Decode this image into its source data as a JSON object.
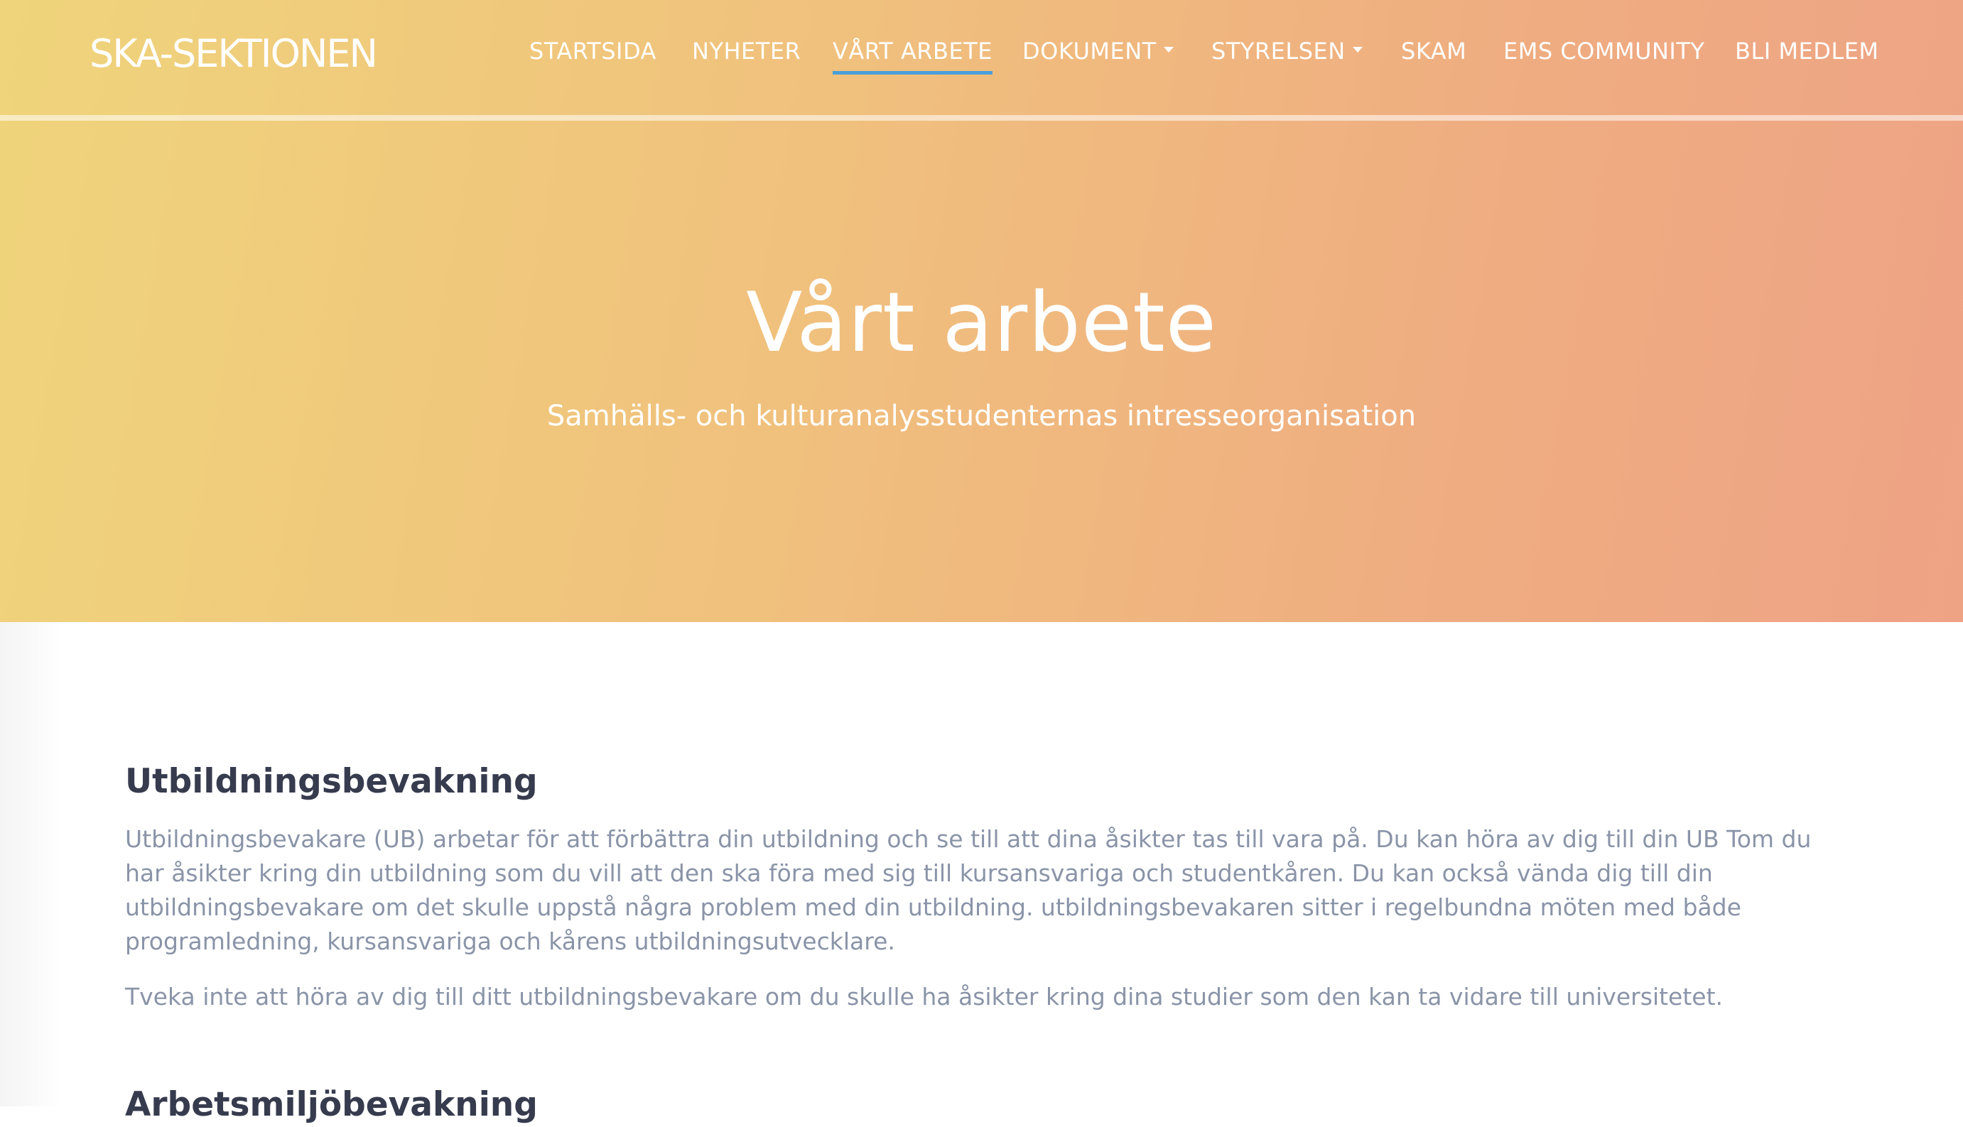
{
  "brand": "SKA-SEKTIONEN",
  "nav": {
    "items": [
      {
        "label": "STARTSIDA",
        "active": false,
        "dropdown": false
      },
      {
        "label": "NYHETER",
        "active": false,
        "dropdown": false
      },
      {
        "label": "VÅRT ARBETE",
        "active": true,
        "dropdown": false
      },
      {
        "label": "DOKUMENT",
        "active": false,
        "dropdown": true
      },
      {
        "label": "STYRELSEN",
        "active": false,
        "dropdown": true
      },
      {
        "label": "SKAM",
        "active": false,
        "dropdown": false
      },
      {
        "label": "EMS COMMUNITY",
        "active": false,
        "dropdown": false
      },
      {
        "label": "BLI MEDLEM",
        "active": false,
        "dropdown": false
      }
    ]
  },
  "hero": {
    "title": "Vårt arbete",
    "subtitle": "Samhälls- och kulturanalysstudenternas intresseorganisation"
  },
  "sections": [
    {
      "heading": "Utbildningsbevakning",
      "paragraphs": [
        "Utbildningsbevakare (UB) arbetar för att förbättra din utbildning och se till att dina åsikter tas till vara på. Du kan höra av dig till din UB Tom du har åsikter kring din utbildning som du vill att den ska föra med sig till kursansvariga och studentkåren. Du kan också vända dig till din utbildningsbevakare om det skulle uppstå några problem med din utbildning. utbildningsbevakaren sitter i regelbundna möten med både programledning, kursansvariga och kårens utbildningsutvecklare.",
        "Tveka inte att höra av dig till ditt utbildningsbevakare om du skulle ha åsikter kring dina studier som den kan ta vidare till universitetet."
      ]
    },
    {
      "heading": "Arbetsmiljöbevakning"
    }
  ],
  "colors": {
    "gradient_start": "#efd47b",
    "gradient_end": "#eea385",
    "active_underline": "#4a9fd8",
    "heading": "#363b4e",
    "body_text": "#8a94a8"
  }
}
